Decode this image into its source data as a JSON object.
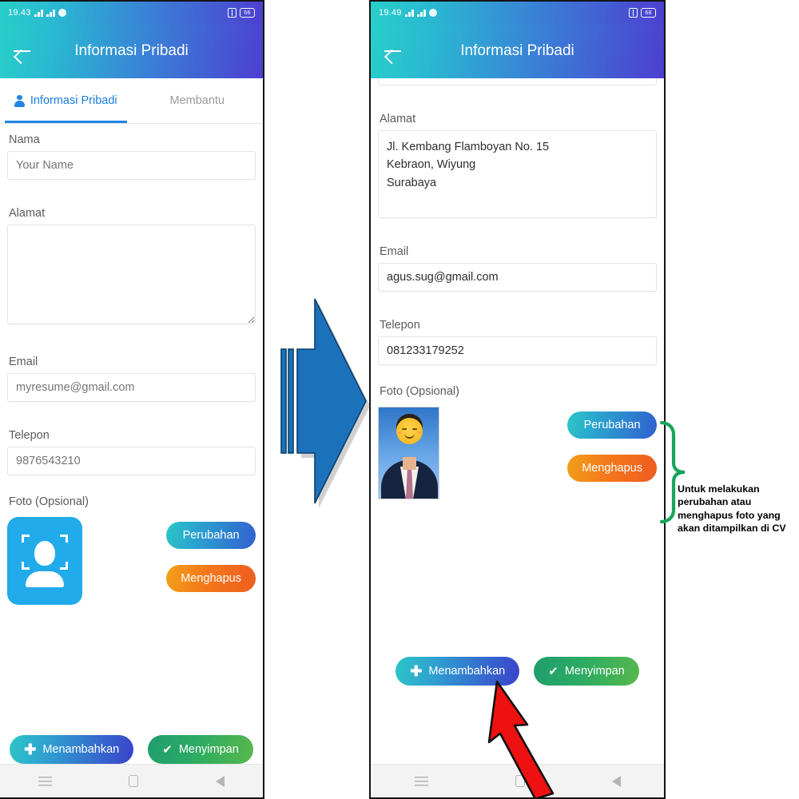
{
  "left_phone": {
    "statusbar": {
      "time": "19.43",
      "battery": "66",
      "signal_icon": "signal-bars-icon",
      "wifi_icon": "wifi-icon",
      "sim_icon": "sim-card-icon",
      "battery_icon": "battery-icon"
    },
    "appbar": {
      "title": "Informasi Pribadi",
      "back_icon": "back-arrow-icon"
    },
    "tabs": [
      {
        "label": "Informasi Pribadi",
        "icon": "person-icon",
        "active": true
      },
      {
        "label": "Membantu",
        "icon": "",
        "active": false
      }
    ],
    "fields": [
      {
        "label": "Nama",
        "placeholder": "Your Name",
        "value": ""
      },
      {
        "label": "Alamat",
        "placeholder": "",
        "value": ""
      },
      {
        "label": "Email",
        "placeholder": "myresume@gmail.com",
        "value": ""
      },
      {
        "label": "Telepon",
        "placeholder": "9876543210",
        "value": ""
      }
    ],
    "photo": {
      "label": "Foto (Opsional)",
      "placeholder_icon": "person-photo-placeholder-icon",
      "change_label": "Perubahan",
      "delete_label": "Menghapus"
    },
    "bottom": {
      "add_label": "Menambahkan",
      "add_icon": "plus-icon",
      "save_label": "Menyimpan",
      "save_icon": "check-icon"
    },
    "navbar": {
      "menu_icon": "menu-icon",
      "home_icon": "home-icon",
      "back_icon": "back-triangle-icon"
    }
  },
  "right_phone": {
    "statusbar": {
      "time": "19.49",
      "battery": "68",
      "signal_icon": "signal-bars-icon",
      "wifi_icon": "wifi-icon",
      "sim_icon": "sim-card-icon",
      "battery_icon": "battery-icon"
    },
    "appbar": {
      "title": "Informasi Pribadi",
      "back_icon": "back-arrow-icon"
    },
    "fields": [
      {
        "label": "Alamat",
        "value": "Jl. Kembang Flamboyan No. 15\nKebraon, Wiyung\nSurabaya"
      },
      {
        "label": "Email",
        "value": "agus.sug@gmail.com"
      },
      {
        "label": "Telepon",
        "value": "081233179252"
      }
    ],
    "photo": {
      "label": "Foto (Opsional)",
      "image_alt": "pas-foto-man-in-suit-with-emoji-face",
      "change_label": "Perubahan",
      "delete_label": "Menghapus"
    },
    "bottom": {
      "add_label": "Menambahkan",
      "add_icon": "plus-icon",
      "save_label": "Menyimpan",
      "save_icon": "check-icon"
    },
    "navbar": {
      "menu_icon": "menu-icon",
      "home_icon": "home-icon",
      "back_icon": "back-triangle-icon"
    }
  },
  "annotations": {
    "flow_arrow_icon": "blue-right-arrow",
    "brace_icon": "green-curly-brace",
    "note": "Untuk melakukan perubahan atau menghapus foto yang akan ditampilkan di CV",
    "pointer_icon": "red-arrow-pointing-up"
  },
  "colors": {
    "appbar_gradient_start": "#28cfc9",
    "appbar_gradient_end": "#4d3fd0",
    "tab_active": "#2186e3",
    "btn_change": "#2aa7cf",
    "btn_delete": "#f4781b",
    "btn_save": "#2bab63",
    "photo_placeholder": "#22abeb",
    "brace_green": "#16a55a",
    "pointer_red": "#ee1111",
    "flow_arrow_blue": "#1f6fb8"
  }
}
